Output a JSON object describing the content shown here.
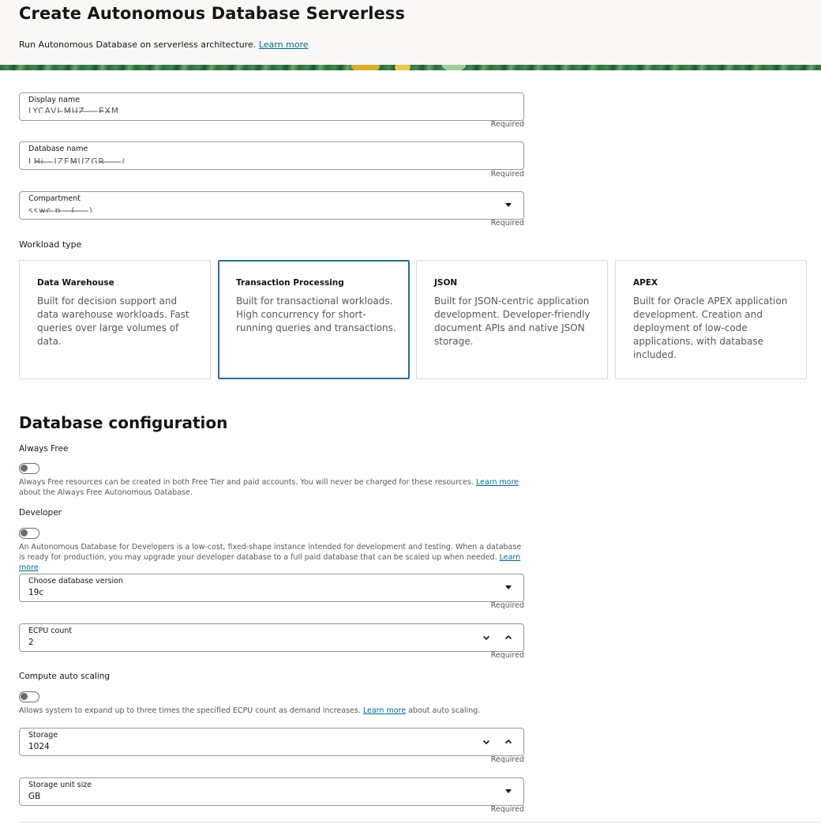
{
  "header": {
    "title": "Create Autonomous Database Serverless",
    "subtitle": "Run Autonomous Database on serverless architecture.",
    "learn_more": "Learn more"
  },
  "fields": {
    "display_name": {
      "label": "Display name",
      "value": "LYCAVI  ̶M̶U̶Z̶ ̶ ̶ ̶ ̶E̶X̶M",
      "required": "Required"
    },
    "database_name": {
      "label": "Database name",
      "value": "LH̶i̶ ̶ ̶ ̶IZEM̶UZGR̶ ̶ ̶ ̶ ̶ ̶(",
      "required": "Required"
    },
    "compartment": {
      "label": "Compartment",
      "value": "ssw̶c̶ ̶p̶ ̶ ̶ ̶(̶ ̶ ̶ ̶ ̶)",
      "required": "Required"
    }
  },
  "workload": {
    "label": "Workload type",
    "cards": [
      {
        "title": "Data Warehouse",
        "desc": "Built for decision support and data warehouse workloads. Fast queries over large volumes of data."
      },
      {
        "title": "Transaction Processing",
        "desc": "Built for transactional workloads. High concurrency for short-running queries and transactions."
      },
      {
        "title": "JSON",
        "desc": "Built for JSON-centric application development. Developer-friendly document APIs and native JSON storage."
      },
      {
        "title": "APEX",
        "desc": "Built for Oracle APEX application development. Creation and deployment of low-code applications, with database included."
      }
    ],
    "selected_index": 1
  },
  "config": {
    "title": "Database configuration",
    "always_free": {
      "label": "Always Free",
      "help_before": "Always Free resources can be created in both Free Tier and paid accounts. You will never be charged for these resources.",
      "help_link": "Learn more",
      "help_after": "about the Always Free Autonomous Database."
    },
    "developer": {
      "label": "Developer",
      "help_before": "An Autonomous Database for Developers is a low-cost, fixed-shape instance intended for development and testing. When a database is ready for production, you may upgrade your developer database to a full paid database that can be scaled up when needed.",
      "help_link": "Learn more"
    },
    "db_version": {
      "label": "Choose database version",
      "value": "19c",
      "required": "Required"
    },
    "ecpu_count": {
      "label": "ECPU count",
      "value": "2",
      "required": "Required"
    },
    "auto_scaling": {
      "label": "Compute auto scaling",
      "help_before": "Allows system to expand up to three times the specified ECPU count as demand increases.",
      "help_link": "Learn more",
      "help_after": "about auto scaling."
    },
    "storage": {
      "label": "Storage",
      "value": "1024",
      "required": "Required"
    },
    "storage_unit": {
      "label": "Storage unit size",
      "value": "GB",
      "required": "Required"
    }
  }
}
